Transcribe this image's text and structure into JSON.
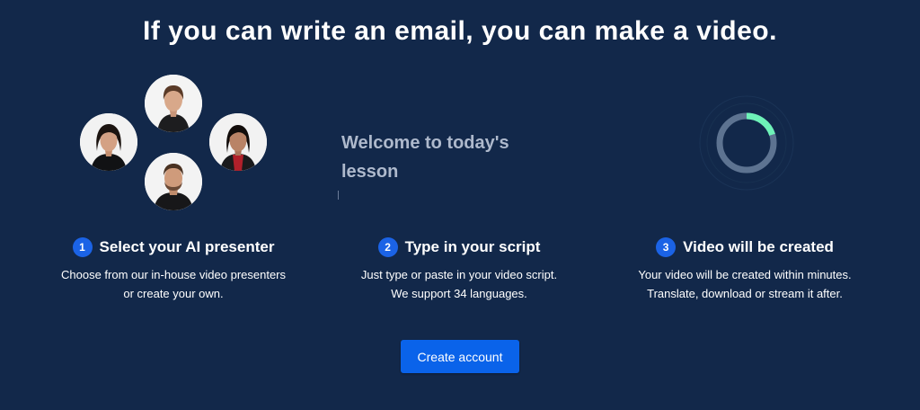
{
  "colors": {
    "background": "#12284a",
    "accent_blue": "#0a63ea",
    "progress_green": "#6ef2b8",
    "progress_track": "#5d7391",
    "preview_text": "#aeb9cc"
  },
  "headline": "If you can write an email, you can make a video.",
  "presenters": {
    "avatars": [
      {
        "name": "presenter-woman-black-top"
      },
      {
        "name": "presenter-woman-dark-hair"
      },
      {
        "name": "presenter-woman-red-top"
      },
      {
        "name": "presenter-man-beard"
      }
    ]
  },
  "script_preview": {
    "text": "Welcome to today's lesson"
  },
  "progress": {
    "fraction": 0.2
  },
  "steps": [
    {
      "number": "1",
      "title": "Select your AI presenter",
      "desc_line1": "Choose from our in-house video presenters",
      "desc_line2": "or create your own."
    },
    {
      "number": "2",
      "title": "Type in your script",
      "desc_line1": "Just type or paste in your video script.",
      "desc_line2": "We support 34 languages."
    },
    {
      "number": "3",
      "title": "Video will be created",
      "desc_line1": "Your video will be created within minutes.",
      "desc_line2": "Translate, download or stream it after."
    }
  ],
  "cta": {
    "label": "Create account"
  }
}
